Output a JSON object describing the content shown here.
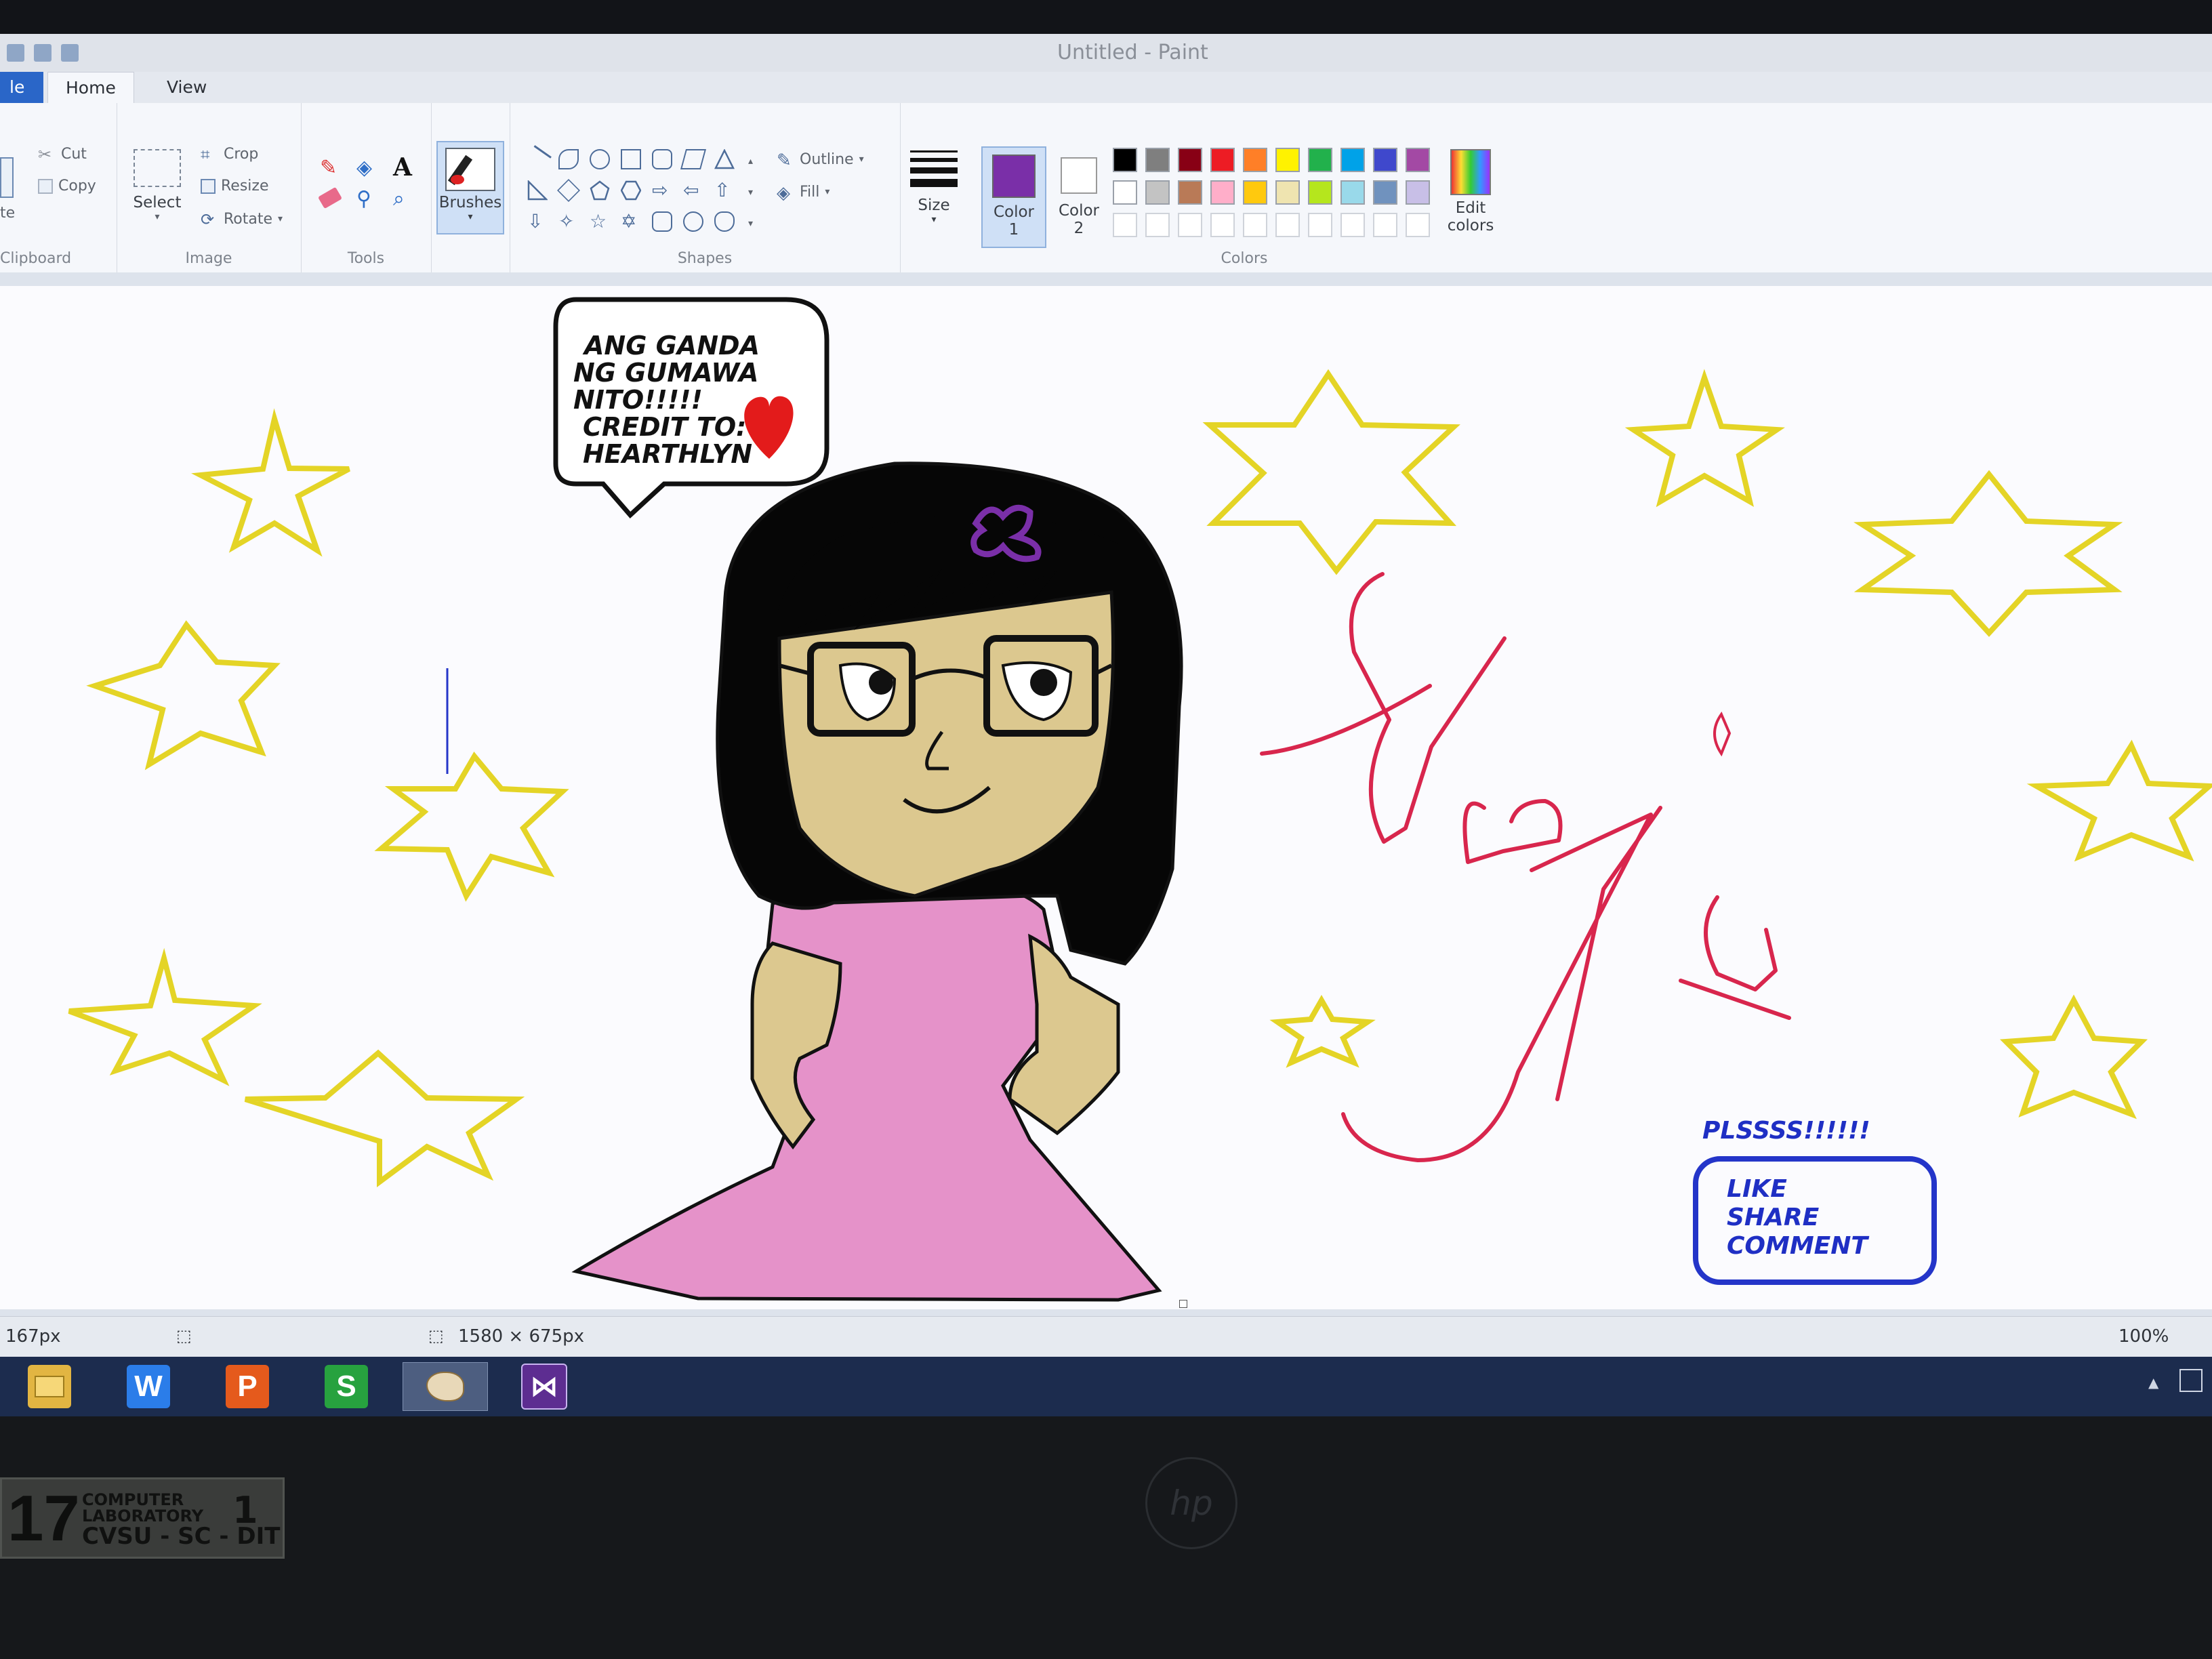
{
  "window": {
    "title": "Untitled - Paint"
  },
  "tabs": [
    {
      "label": "le"
    },
    {
      "label": "Home"
    },
    {
      "label": "View"
    }
  ],
  "ribbon": {
    "clipboard": {
      "paste_label": "te",
      "cut": "Cut",
      "copy": "Copy",
      "group": "Clipboard"
    },
    "image": {
      "select": "Select",
      "crop": "Crop",
      "resize": "Resize",
      "rotate": "Rotate",
      "group": "Image"
    },
    "tools": {
      "group": "Tools"
    },
    "brushes": {
      "label": "Brushes"
    },
    "shapes": {
      "outline": "Outline",
      "fill": "Fill",
      "group": "Shapes"
    },
    "size": {
      "label": "Size"
    },
    "color1": {
      "label": "Color",
      "num": "1",
      "value": "#7a2fa8"
    },
    "color2": {
      "label": "Color",
      "num": "2",
      "value": "#ffffff"
    },
    "colors_group": "Colors",
    "edit_colors": {
      "line1": "Edit",
      "line2": "colors"
    },
    "palette_row1": [
      "#000000",
      "#7f7f7f",
      "#880015",
      "#ed1c24",
      "#ff7f27",
      "#fff200",
      "#22b14c",
      "#00a2e8",
      "#3f48cc",
      "#a349a4"
    ],
    "palette_row2": [
      "#ffffff",
      "#c3c3c3",
      "#b97a57",
      "#ffaec9",
      "#ffc90e",
      "#efe4b0",
      "#b5e61d",
      "#99d9ea",
      "#7092be",
      "#c8bfe7"
    ]
  },
  "drawing": {
    "bubble_lines": [
      "ANG GANDA",
      "NG GUMAWA",
      "NITO!!!!!",
      "CREDIT TO:",
      "HEARTHLYN"
    ],
    "plea": "PLSSSS!!!!!!",
    "like_lines": [
      "LIKE",
      "SHARE",
      "COMMENT"
    ],
    "signature": "Maja",
    "colors": {
      "stars": "#e4d426",
      "dress": "#e592c9",
      "skin": "#dcc88f",
      "hair": "#060606",
      "signature": "#d8264d",
      "like_box": "#2435c9",
      "bow": "#7a2fa8",
      "heart": "#e31b1b"
    }
  },
  "status": {
    "position": "167px",
    "dimensions": "1580 × 675px",
    "zoom": "100%"
  },
  "taskbar": {
    "apps": [
      {
        "name": "file-explorer-icon"
      },
      {
        "name": "writer-icon",
        "glyph": "W",
        "color": "#2b7de9"
      },
      {
        "name": "presentation-icon",
        "glyph": "P",
        "color": "#e55a1c"
      },
      {
        "name": "spreadsheet-icon",
        "glyph": "S",
        "color": "#27a23f"
      },
      {
        "name": "paint-icon"
      },
      {
        "name": "visual-studio-icon"
      }
    ]
  },
  "bezel": {
    "sticker": {
      "number": "17",
      "line1a": "COMPUTER",
      "line1b": "LABORATORY",
      "line2": "CVSU - SC - DIT",
      "unit": "1"
    }
  }
}
